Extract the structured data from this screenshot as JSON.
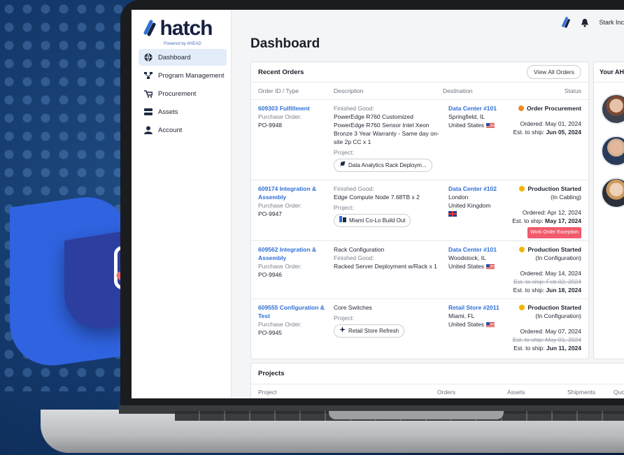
{
  "brand": {
    "name": "hatch",
    "tagline": "Powered by AHEAD",
    "accent": "#2f6fd6"
  },
  "topbar": {
    "org_name": "Stark Inc",
    "icons": [
      "hatch-logo-icon",
      "bell-icon"
    ]
  },
  "sidebar": {
    "items": [
      {
        "label": "Dashboard",
        "icon": "globe-icon",
        "active": true
      },
      {
        "label": "Program Management",
        "icon": "network-icon",
        "active": false
      },
      {
        "label": "Procurement",
        "icon": "cart-icon",
        "active": false
      },
      {
        "label": "Assets",
        "icon": "server-icon",
        "active": false
      },
      {
        "label": "Account",
        "icon": "user-icon",
        "active": false
      }
    ]
  },
  "page": {
    "title": "Dashboard"
  },
  "recent_orders": {
    "title": "Recent Orders",
    "view_all_label": "View All Orders",
    "columns": [
      "Order ID / Type",
      "Description",
      "Destination",
      "Status"
    ],
    "rows": [
      {
        "id": "609303 Fulfillment",
        "po_label": "Purchase Order:",
        "po": "PO-9948",
        "desc_label": "Finished Good:",
        "desc": "PowerEdge R760 Customized PowerEdge R760 Sensor Intel Xeon Bronze 3 Year Warranty - Same day on-site 2p CC x 1",
        "project_label": "Project:",
        "project": "Data Analytics Rack Deploym...",
        "dest_name": "Data Center #101",
        "dest_city": "Springfield, IL",
        "dest_country": "United States",
        "status": "Order Procurement",
        "status_sub": "",
        "status_color": "#f08a24",
        "ordered": "Ordered: May 01, 2024",
        "old_ship": "",
        "ship_label": "Est. to ship:",
        "ship": "Jun 05, 2024",
        "exception": ""
      },
      {
        "id": "609174 Integration & Assembly",
        "po_label": "Purchase Order:",
        "po": "PO-9947",
        "desc_label": "Finished Good:",
        "desc": "Edge Compute Node 7.68TB x 2",
        "project_label": "Project:",
        "project": "Miami Co-Lo Build Out",
        "dest_name": "Data Center #102",
        "dest_city": "London",
        "dest_country": "United Kingdom",
        "status": "Production Started",
        "status_sub": "(In Cabling)",
        "status_color": "#f5b400",
        "ordered": "Ordered: Apr 12, 2024",
        "old_ship": "",
        "ship_label": "Est. to ship:",
        "ship": "May 17, 2024",
        "exception": "Work Order Exception"
      },
      {
        "id": "609562 Integration & Assembly",
        "po_label": "Purchase Order:",
        "po": "PO-9946",
        "desc_label": "Rack Configuration",
        "desc": "Racked Server Deployment w/Rack x 1",
        "desc_label2": "Finished Good:",
        "project_label": "",
        "project": "",
        "dest_name": "Data Center #101",
        "dest_city": "Woodstock, IL",
        "dest_country": "United States",
        "status": "Production Started",
        "status_sub": "(In Configuration)",
        "status_color": "#f5b400",
        "ordered": "Ordered: May 14, 2024",
        "old_ship": "Est. to ship: Feb 02, 2024",
        "ship_label": "Est. to ship:",
        "ship": "Jun 18, 2024",
        "exception": ""
      },
      {
        "id": "609555 Configuration & Test",
        "po_label": "Purchase Order:",
        "po": "PO-9945",
        "desc_label": "Core Switches",
        "desc": "",
        "project_label": "Project:",
        "project": "Retail Store Refresh",
        "dest_name": "Retail Store #2011",
        "dest_city": "Miami, FL",
        "dest_country": "United States",
        "status": "Production Started",
        "status_sub": "(In Configuration)",
        "status_color": "#f5b400",
        "ordered": "Ordered: May 07, 2024",
        "old_ship": "Est. to ship: May 01, 2024",
        "ship_label": "Est. to ship:",
        "ship": "Jun 11, 2024",
        "exception": ""
      }
    ]
  },
  "side_panel": {
    "title": "Your AH"
  },
  "projects": {
    "title": "Projects",
    "columns": [
      "Project",
      "Orders",
      "Assets",
      "Shipments",
      "Quot"
    ]
  }
}
